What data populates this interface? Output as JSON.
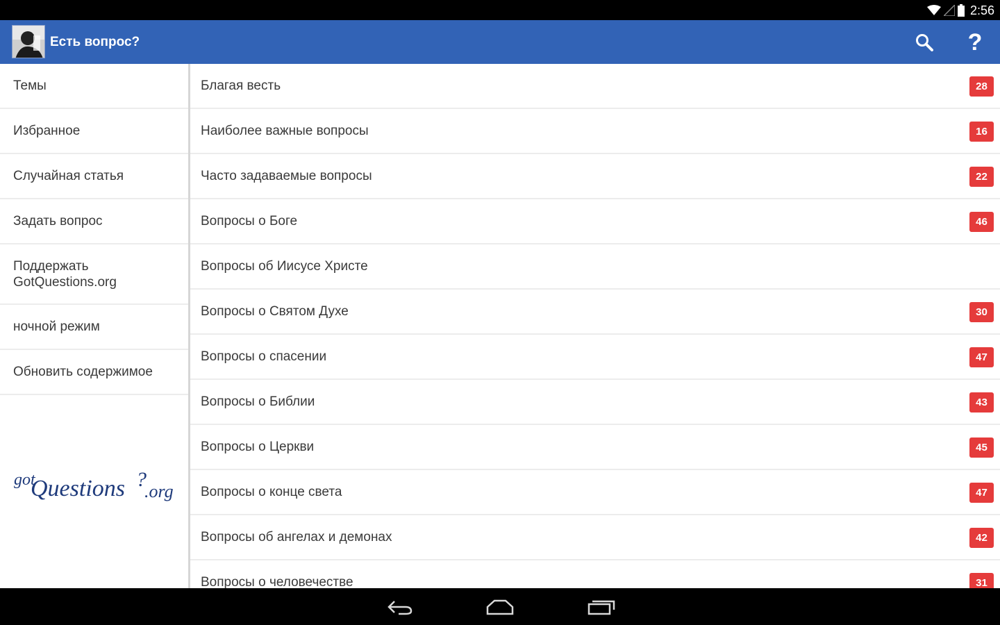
{
  "status_bar": {
    "time": "2:56",
    "icons": [
      "wifi-icon",
      "signal-icon",
      "battery-icon"
    ]
  },
  "action_bar": {
    "title": "Есть вопрос?",
    "actions": [
      "search-icon",
      "help-icon"
    ],
    "help_glyph": "?"
  },
  "sidebar": {
    "items": [
      {
        "label": "Темы"
      },
      {
        "label": "Избранное"
      },
      {
        "label": "Случайная статья"
      },
      {
        "label": "Задать вопрос"
      },
      {
        "label": "Поддержать GotQuestions.org"
      },
      {
        "label": "ночной режим"
      },
      {
        "label": "Обновить содержимое"
      }
    ],
    "logo_text": "gotQuestions?.org"
  },
  "topics": [
    {
      "title": "Благая весть",
      "count": "28"
    },
    {
      "title": "Наиболее важные вопросы",
      "count": "16"
    },
    {
      "title": "Часто задаваемые вопросы",
      "count": "22"
    },
    {
      "title": "Вопросы о Боге",
      "count": "46"
    },
    {
      "title": "Вопросы об Иисусе Христе",
      "count": ""
    },
    {
      "title": "Вопросы о Святом Духе",
      "count": "30"
    },
    {
      "title": "Вопросы о спасении",
      "count": "47"
    },
    {
      "title": "Вопросы о Библии",
      "count": "43"
    },
    {
      "title": "Вопросы о Церкви",
      "count": "45"
    },
    {
      "title": "Вопросы о конце света",
      "count": "47"
    },
    {
      "title": "Вопросы об ангелах и демонах",
      "count": "42"
    },
    {
      "title": "Вопросы о человечестве",
      "count": "31"
    }
  ],
  "colors": {
    "action_bar": "#3263b6",
    "badge": "#e53b3b",
    "logo": "#1e3a7b"
  },
  "system_nav": [
    "back-icon",
    "home-icon",
    "recent-apps-icon"
  ]
}
